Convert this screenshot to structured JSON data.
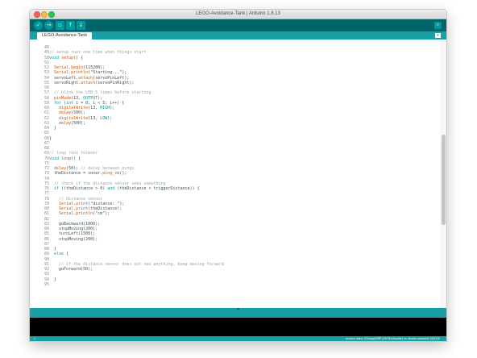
{
  "window": {
    "title": "LEGO-Avoidance-Tank | Arduino 1.8.13"
  },
  "toolbar": {
    "verify_icon": "check-icon",
    "upload_icon": "arrow-right-icon",
    "new_icon": "new-file-icon",
    "open_icon": "arrow-up-icon",
    "save_icon": "arrow-down-icon",
    "serial_monitor_icon": "magnifier-icon",
    "accent_color": "#006468"
  },
  "tabs": [
    {
      "label": "LEGO-Avoidance-Tank"
    }
  ],
  "editor": {
    "lines": [
      {
        "n": "48",
        "text": ""
      },
      {
        "n": "49",
        "text": "// setup runs one time when things start"
      },
      {
        "n": "50",
        "text": "void setup() {"
      },
      {
        "n": "51",
        "text": ""
      },
      {
        "n": "52",
        "text": "  Serial.begin(115200);"
      },
      {
        "n": "53",
        "text": "  Serial.println(\"Starting...\");"
      },
      {
        "n": "54",
        "text": "  servoLeft.attach(servoPinLeft);"
      },
      {
        "n": "55",
        "text": "  servoRight.attach(servoPinRight);"
      },
      {
        "n": "56",
        "text": ""
      },
      {
        "n": "57",
        "text": "  // blink the LED 5 times before starting"
      },
      {
        "n": "58",
        "text": "  pinMode(13, OUTPUT);"
      },
      {
        "n": "59",
        "text": "  for (int i = 0; i < 5; i++) {"
      },
      {
        "n": "60",
        "text": "    digitalWrite(13, HIGH);"
      },
      {
        "n": "61",
        "text": "    delay(500);"
      },
      {
        "n": "62",
        "text": "    digitalWrite(13, LOW);"
      },
      {
        "n": "63",
        "text": "    delay(500);"
      },
      {
        "n": "64",
        "text": "  }"
      },
      {
        "n": "65",
        "text": ""
      },
      {
        "n": "66",
        "text": "}"
      },
      {
        "n": "67",
        "text": ""
      },
      {
        "n": "68",
        "text": ""
      },
      {
        "n": "69",
        "text": "// loop runs forever"
      },
      {
        "n": "70",
        "text": "void loop() {"
      },
      {
        "n": "71",
        "text": ""
      },
      {
        "n": "72",
        "text": "  delay(50); // delay between pings"
      },
      {
        "n": "73",
        "text": "  theDistance = sonar.ping_cm();"
      },
      {
        "n": "74",
        "text": ""
      },
      {
        "n": "75",
        "text": "  // check if the distance sensor sees something"
      },
      {
        "n": "76",
        "text": "  if ((theDistance > 0) and (theDistance < triggerDistance)) {"
      },
      {
        "n": "77",
        "text": ""
      },
      {
        "n": "78",
        "text": "    // distance sensor"
      },
      {
        "n": "79",
        "text": "    Serial.print(\"distance: \");"
      },
      {
        "n": "80",
        "text": "    Serial.print(theDistance);"
      },
      {
        "n": "81",
        "text": "    Serial.println(\"cm\");"
      },
      {
        "n": "82",
        "text": ""
      },
      {
        "n": "83",
        "text": "    goBackward(1000);"
      },
      {
        "n": "84",
        "text": "    stopMoving(200);"
      },
      {
        "n": "85",
        "text": "    turnLeft(1500);"
      },
      {
        "n": "86",
        "text": "    stopMoving(200);"
      },
      {
        "n": "87",
        "text": ""
      },
      {
        "n": "88",
        "text": "  }"
      },
      {
        "n": "89",
        "text": "  else {"
      },
      {
        "n": "90",
        "text": ""
      },
      {
        "n": "91",
        "text": "    // if the distance sensor does not see anything, keep moving forward"
      },
      {
        "n": "92",
        "text": "    goForward(50);"
      },
      {
        "n": "93",
        "text": ""
      },
      {
        "n": "94",
        "text": "  }"
      },
      {
        "n": "95",
        "text": ""
      }
    ]
  },
  "status": {
    "line_number": "1",
    "board_info": "Arduino Nano, ATmega328P (Old Bootloader) on /dev/cu.usbserial-1411110"
  }
}
